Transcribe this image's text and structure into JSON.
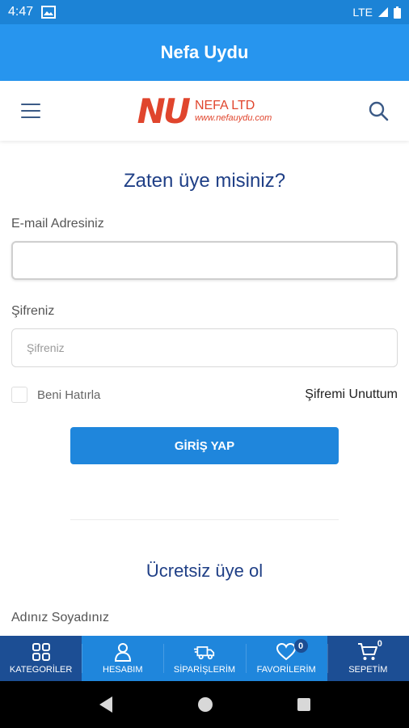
{
  "status_bar": {
    "time": "4:47",
    "network": "LTE"
  },
  "app_bar": {
    "title": "Nefa Uydu"
  },
  "header": {
    "logo_mark": "NU",
    "logo_name": "NEFA LTD",
    "logo_url": "www.nefauydu.com"
  },
  "login": {
    "title": "Zaten üye misiniz?",
    "email_label": "E-mail Adresiniz",
    "email_value": "",
    "password_label": "Şifreniz",
    "password_placeholder": "Şifreniz",
    "remember_label": "Beni Hatırla",
    "forgot_label": "Şifremi Unuttum",
    "submit_label": "GİRİŞ YAP"
  },
  "signup": {
    "title": "Ücretsiz üye ol",
    "name_label": "Adınız Soyadınız"
  },
  "bottom_nav": {
    "categories": "KATEGORİLER",
    "account": "HESABIM",
    "orders": "SİPARİŞLERİM",
    "favorites": "FAVORİLERİM",
    "favorites_count": "0",
    "cart": "SEPETİM",
    "cart_count": "0"
  },
  "colors": {
    "status_bar": "#1c83d6",
    "app_bar": "#2795ee",
    "accent": "#1f86dc",
    "title_blue": "#1f3f86",
    "logo_red": "#e0452d",
    "nav_dark": "#1c4e94"
  },
  "icons": [
    "image-icon",
    "signal-icon",
    "battery-icon",
    "menu-icon",
    "search-icon",
    "grid-icon",
    "user-icon",
    "truck-icon",
    "heart-icon",
    "cart-icon",
    "back-icon",
    "home-icon",
    "recents-icon"
  ]
}
